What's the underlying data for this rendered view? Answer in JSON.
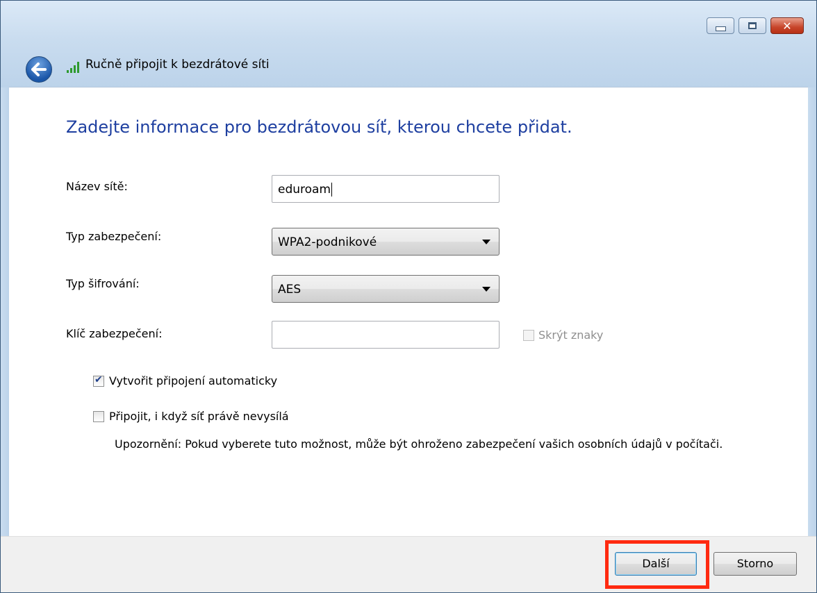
{
  "window": {
    "title": "Ručně připojit k bezdrátové síti",
    "controls": [
      "minimize",
      "maximize",
      "close"
    ]
  },
  "heading": "Zadejte informace pro bezdrátovou síť, kterou chcete přidat.",
  "form": {
    "network_name": {
      "label": "Název sítě:",
      "value": "eduroam"
    },
    "security_type": {
      "label": "Typ zabezpečení:",
      "selected": "WPA2-podnikové"
    },
    "encryption_type": {
      "label": "Typ šifrování:",
      "selected": "AES"
    },
    "security_key": {
      "label": "Klíč zabezpečení:",
      "value": "",
      "hide_chars_label": "Skrýt znaky",
      "hide_chars_checked": false,
      "hide_chars_enabled": false
    }
  },
  "options": {
    "auto_connect": {
      "label": "Vytvořit připojení automaticky",
      "checked": true
    },
    "connect_not_broadcasting": {
      "label": "Připojit, i když síť právě nevysílá",
      "checked": false
    }
  },
  "warning": "Upozornění: Pokud vyberete tuto možnost, může být ohroženo zabezpečení vašich osobních údajů v počítači.",
  "buttons": {
    "next": "Další",
    "cancel": "Storno"
  },
  "colors": {
    "heading": "#1e3fa0",
    "highlight": "#ff2a10",
    "titlebar": "#c9dcef"
  }
}
